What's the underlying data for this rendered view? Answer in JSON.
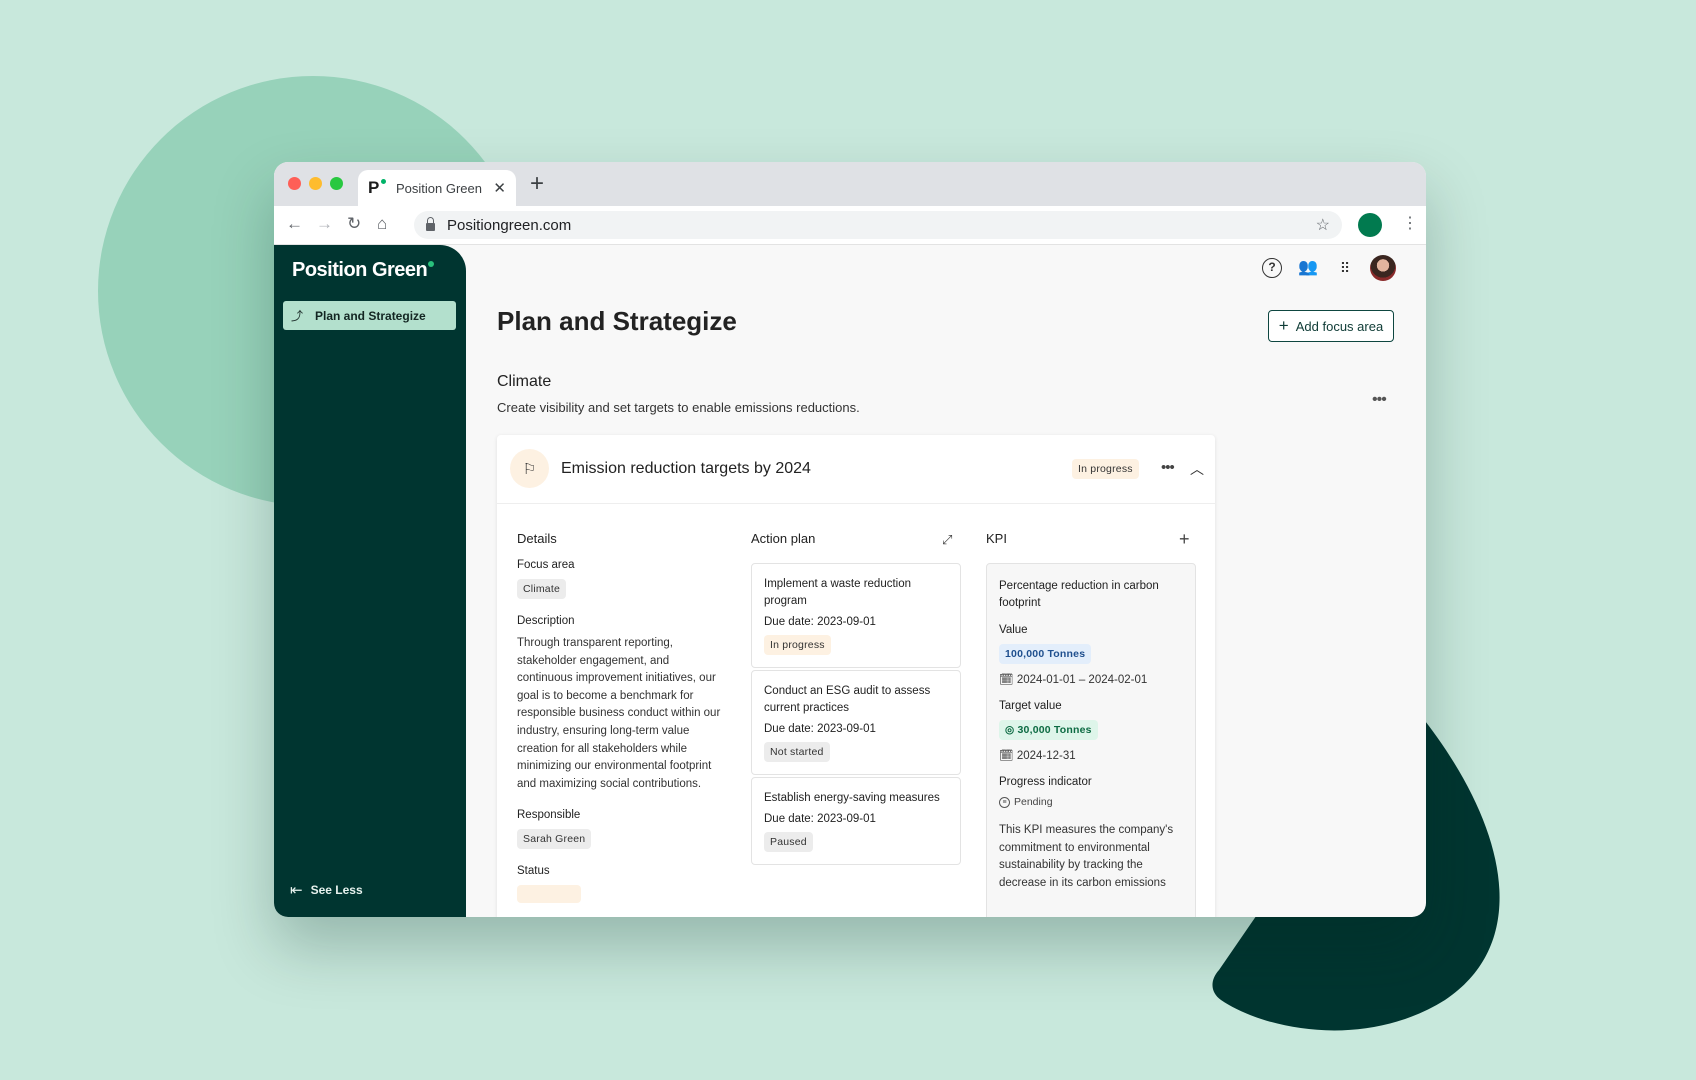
{
  "browser": {
    "tab_title": "Position Green",
    "tab_logo": "P",
    "url": "Positiongreen.com",
    "icons": {
      "back": "arrow-left-icon",
      "forward": "arrow-right-icon",
      "reload": "reload-icon",
      "home": "home-icon",
      "lock": "lock-icon",
      "star": "star-icon",
      "menu": "kebab-icon",
      "close_tab": "close-icon",
      "new_tab": "plus-icon"
    }
  },
  "sidebar": {
    "brand": "Position Green",
    "items": [
      {
        "label": "Plan and Strategize",
        "icon": "strategy-icon",
        "active": true
      }
    ],
    "footer": {
      "label": "See Less",
      "icon": "collapse-left-icon"
    }
  },
  "header_icons": [
    "help-icon",
    "people-icon",
    "apps-grid-icon",
    "user-avatar"
  ],
  "page": {
    "title": "Plan and Strategize",
    "add_button": "Add focus area",
    "section": {
      "title": "Climate",
      "description": "Create visibility and set targets to enable emissions reductions."
    }
  },
  "goal": {
    "title": "Emission reduction targets by 2024",
    "status": "In progress",
    "colors": {
      "in_progress_bg": "#fdf1e2",
      "brand_dark": "#003530",
      "brand_accent": "#29c17c"
    },
    "details": {
      "heading": "Details",
      "focus_area_label": "Focus area",
      "focus_area": "Climate",
      "description_label": "Description",
      "description": "Through transparent reporting, stakeholder engagement, and continuous improvement initiatives, our goal is to become a benchmark for responsible business conduct within our industry, ensuring long-term value creation for all stakeholders while minimizing our environmental footprint and maximizing social contributions.",
      "responsible_label": "Responsible",
      "responsible": "Sarah Green",
      "status_label": "Status"
    },
    "action_plan": {
      "heading": "Action plan",
      "due_label": "Due date:",
      "items": [
        {
          "title": "Implement a waste reduction program",
          "due": "2023-09-01",
          "status": "In progress"
        },
        {
          "title": "Conduct an ESG audit to assess current practices",
          "due": "2023-09-01",
          "status": "Not started"
        },
        {
          "title": "Establish energy-saving measures",
          "due": "2023-09-01",
          "status": "Paused"
        }
      ]
    },
    "kpi": {
      "heading": "KPI",
      "name": "Percentage reduction in carbon footprint",
      "value_label": "Value",
      "value": "100,000 Tonnes",
      "value_period": "2024-01-01 – 2024-02-01",
      "target_label": "Target value",
      "target": "30,000 Tonnes",
      "target_date": "2024-12-31",
      "progress_label": "Progress indicator",
      "progress": "Pending",
      "text": "This KPI measures the company's commitment to environmental sustainability by tracking the decrease in its carbon emissions"
    }
  }
}
